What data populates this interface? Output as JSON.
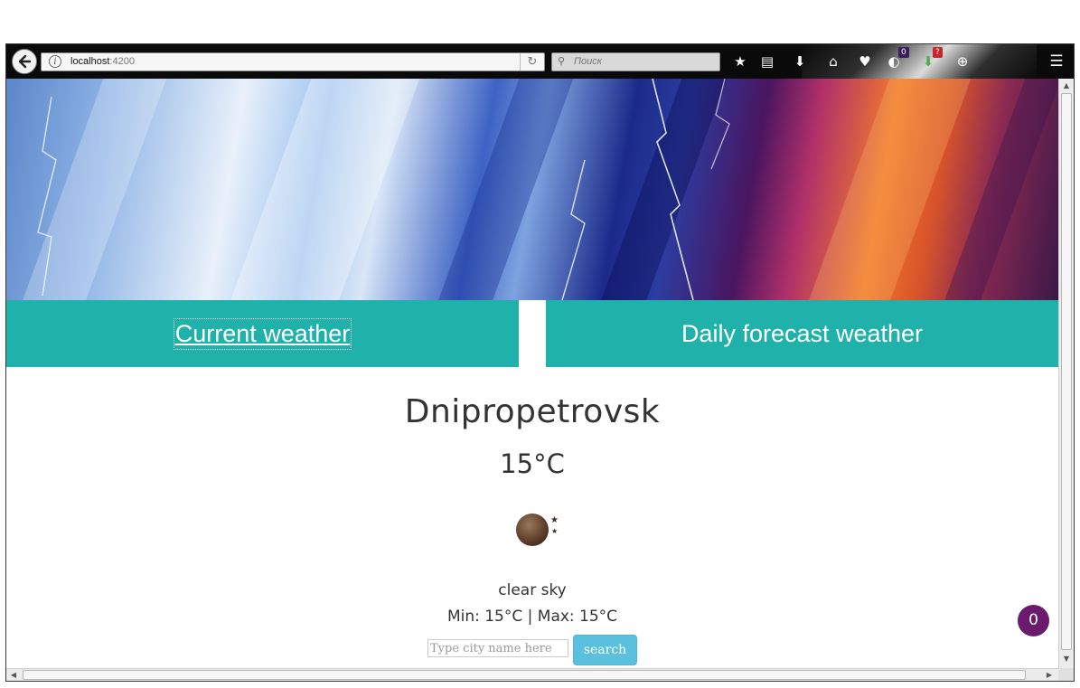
{
  "browser": {
    "url_host": "localhost",
    "url_port": ":4200",
    "search_placeholder": "Поиск",
    "badge_count_a": "0",
    "badge_count_b": "?"
  },
  "tabs": {
    "current_label": "Current weather",
    "daily_label": "Daily forecast weather"
  },
  "weather": {
    "city": "Dnipropetrovsk",
    "temperature": "15°C",
    "description": "clear sky",
    "min_max": "Min: 15°C | Max: 15°C",
    "icon": "clear-sky-night-icon"
  },
  "search": {
    "placeholder": "Type city name here",
    "button_label": "search"
  },
  "fab": {
    "count": "0"
  },
  "colors": {
    "tab_bg": "#20b2aa",
    "search_button": "#5bc0de",
    "fab_bg": "#6a1b6e",
    "toolbar_bg": "#0a0a0a"
  }
}
